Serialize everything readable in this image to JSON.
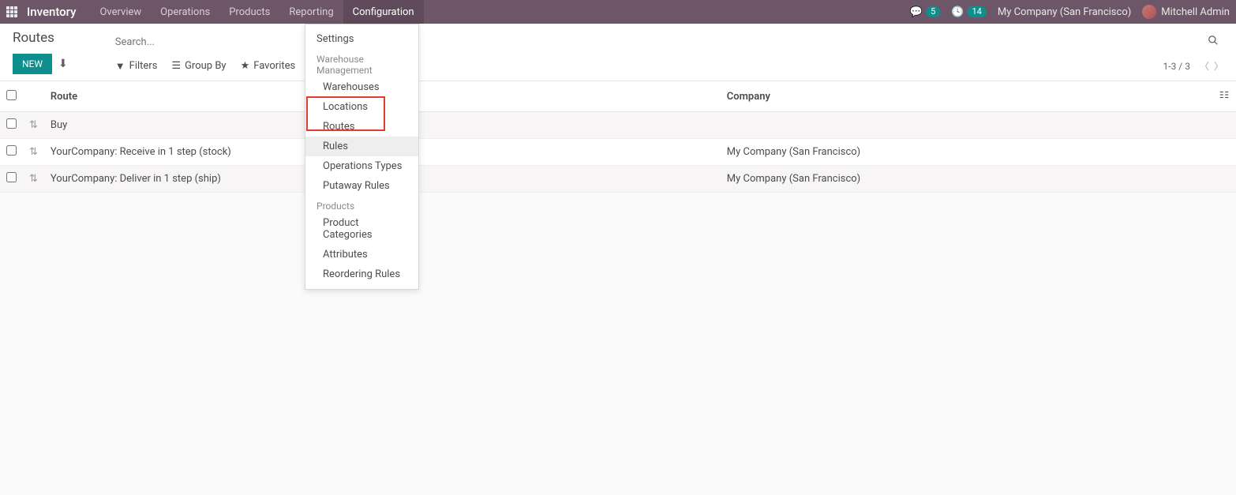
{
  "nav": {
    "brand": "Inventory",
    "items": [
      "Overview",
      "Operations",
      "Products",
      "Reporting",
      "Configuration"
    ],
    "active_index": 4,
    "messages_count": "5",
    "activities_count": "14",
    "company": "My Company (San Francisco)",
    "user": "Mitchell Admin"
  },
  "page": {
    "title": "Routes",
    "new_btn": "NEW",
    "search_placeholder": "Search...",
    "filters_label": "Filters",
    "groupby_label": "Group By",
    "favorites_label": "Favorites",
    "pager": "1-3 / 3"
  },
  "dropdown": {
    "settings": "Settings",
    "wm_header": "Warehouse Management",
    "warehouses": "Warehouses",
    "locations": "Locations",
    "routes": "Routes",
    "rules": "Rules",
    "op_types": "Operations Types",
    "putaway": "Putaway Rules",
    "products_header": "Products",
    "prod_cats": "Product Categories",
    "attributes": "Attributes",
    "reorder": "Reordering Rules"
  },
  "table": {
    "col_route": "Route",
    "col_company": "Company",
    "rows": [
      {
        "route": "Buy",
        "company": ""
      },
      {
        "route": "YourCompany: Receive in 1 step (stock)",
        "company": "My Company (San Francisco)"
      },
      {
        "route": "YourCompany: Deliver in 1 step (ship)",
        "company": "My Company (San Francisco)"
      }
    ]
  }
}
